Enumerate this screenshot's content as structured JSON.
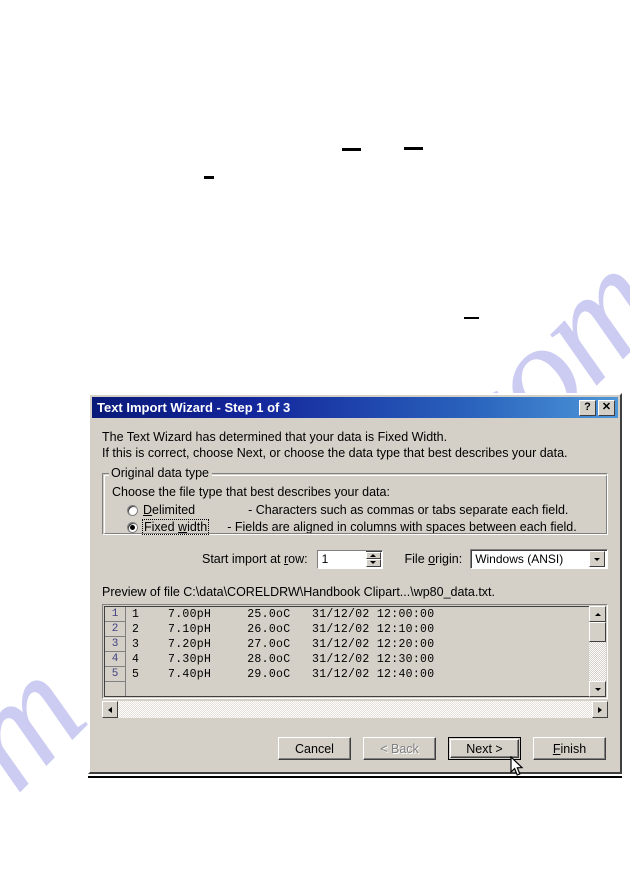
{
  "page": {
    "watermark_main": "ve.com",
    "watermark_left": "m",
    "watermark_color": "#ccccf2"
  },
  "dialog": {
    "title": "Text Import Wizard - Step 1 of 3",
    "titlebar_color_start": "#0a1a7a",
    "titlebar_color_end": "#4d96d8",
    "face_color": "#d4d0c8",
    "titlebar_buttons": [
      {
        "name": "help-button",
        "glyph": "?"
      },
      {
        "name": "close-button",
        "glyph": "✕"
      }
    ],
    "intro": {
      "line1": "The Text Wizard has determined that your data is Fixed Width.",
      "line2": "If this is correct, choose Next, or choose the data type that best describes your data."
    },
    "group": {
      "legend": "Original data type",
      "prompt": "Choose the file type that best describes your data:",
      "options": [
        {
          "name": "radio-delimited",
          "label_pre": "",
          "label_accel": "D",
          "label_post": "elimited",
          "label_full": "Delimited",
          "description": "- Characters such as commas or tabs separate each field.",
          "selected": false,
          "focused": false
        },
        {
          "name": "radio-fixed-width",
          "label_pre": "Fixed ",
          "label_accel": "w",
          "label_post": "idth",
          "label_full": "Fixed width",
          "description": "- Fields are aligned in columns with spaces between each field.",
          "selected": true,
          "focused": true
        }
      ]
    },
    "controls": {
      "start_row_label_pre": "Start import at ",
      "start_row_label_accel": "r",
      "start_row_label_post": "ow:",
      "start_row_value": "1",
      "file_origin_label_pre": "File ",
      "file_origin_label_accel": "o",
      "file_origin_label_post": "rigin:",
      "file_origin_value": "Windows (ANSI)",
      "file_origin_options": [
        "Windows (ANSI)"
      ]
    },
    "preview": {
      "caption": "Preview of file C:\\data\\CORELDRW\\Handbook Clipart...\\wp80_data.txt.",
      "row_numbers": [
        "1",
        "2",
        "3",
        "4",
        "5"
      ],
      "rows": [
        "1    7.00pH     25.0oC   31/12/02 12:00:00",
        "2    7.10pH     26.0oC   31/12/02 12:10:00",
        "3    7.20pH     27.0oC   31/12/02 12:20:00",
        "4    7.30pH     28.0oC   31/12/02 12:30:00",
        "5    7.40pH     29.0oC   31/12/02 12:40:00"
      ]
    },
    "buttons": [
      {
        "name": "cancel-button",
        "label": "Cancel",
        "accel": "",
        "label_pre": "Cancel",
        "label_post": "",
        "state": "enabled",
        "default": false
      },
      {
        "name": "back-button",
        "label": "< Back",
        "accel": "",
        "label_pre": "< Back",
        "label_post": "",
        "state": "disabled",
        "default": false
      },
      {
        "name": "next-button",
        "label": "Next >",
        "accel": "",
        "label_pre": "Next >",
        "label_post": "",
        "state": "enabled",
        "default": true
      },
      {
        "name": "finish-button",
        "label": "Finish",
        "accel": "F",
        "label_pre": "",
        "label_post": "inish",
        "state": "enabled",
        "default": false
      }
    ]
  }
}
